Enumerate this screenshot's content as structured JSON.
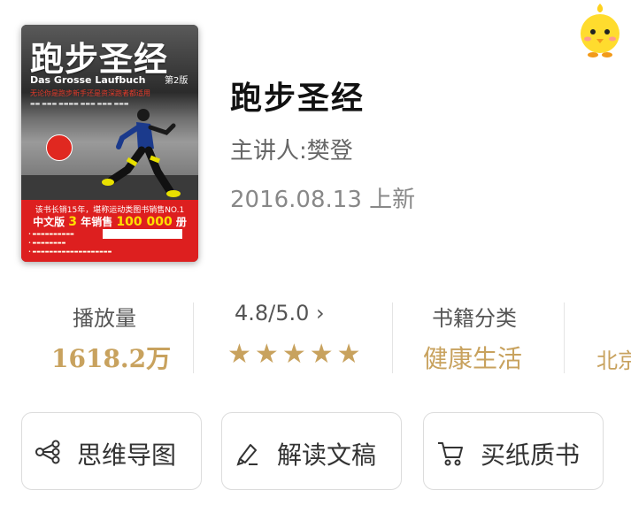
{
  "book": {
    "title": "跑步圣经",
    "speaker": "主讲人:樊登",
    "date": "2016.08.13 上新",
    "cover": {
      "title": "跑步圣经",
      "edition": "第2版",
      "subtitle": "Das Grosse Laufbuch",
      "tagline": "无论你是跑步新手还是资深跑者都适用",
      "band_line1": "该书长销15年，堪称运动类图书销售NO.1",
      "band_line2_pre": "中文版",
      "band_line2_num": "3",
      "band_line2_mid": "年销售",
      "band_line2_count": "100 000",
      "band_line2_post": "册",
      "accent": "#dd1f1f"
    }
  },
  "stats": {
    "plays_label": "播放量",
    "plays_value": "1618.2万",
    "rating_label": "4.8/5.0 ›",
    "rating_stars": 5,
    "category_label": "书籍分类",
    "category_value": "健康生活",
    "publisher_value": "北京"
  },
  "actions": {
    "mindmap_label": "思维导图",
    "transcript_label": "解读文稿",
    "buy_label": "买纸质书"
  },
  "colors": {
    "accent_gold": "#c8a25e",
    "text_dark": "#111111",
    "text_gray": "#666666"
  },
  "icons": {
    "mindmap": "mindmap-icon",
    "transcript": "pen-icon",
    "buy": "cart-icon",
    "mascot": "mascot-icon",
    "star": "star-icon"
  }
}
